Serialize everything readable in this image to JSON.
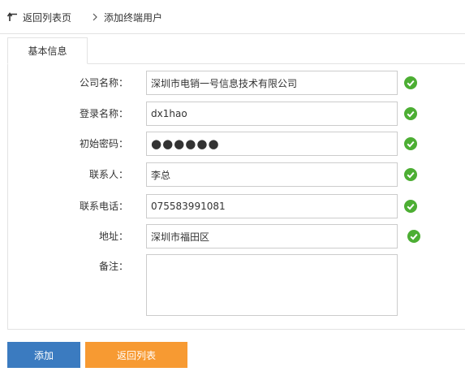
{
  "nav": {
    "back_label": "返回列表页",
    "crumb_label": "添加终端用户"
  },
  "tab": {
    "label": "基本信息"
  },
  "form": {
    "company_name": {
      "label": "公司名称：",
      "value": "深圳市电销一号信息技术有限公司"
    },
    "login_name": {
      "label": "登录名称：",
      "value": "dx1hao"
    },
    "initial_password": {
      "label": "初始密码：",
      "value": "●●●●●●"
    },
    "contact": {
      "label": "联系人：",
      "value": "李总"
    },
    "phone": {
      "label": "联系电话：",
      "value": "075583991081"
    },
    "address": {
      "label": "地址：",
      "value": "深圳市福田区"
    },
    "remark": {
      "label": "备注：",
      "value": ""
    }
  },
  "actions": {
    "add_label": "添加",
    "back_label": "返回列表"
  },
  "colors": {
    "add_button": "#3b7bc0",
    "back_button": "#f79a32",
    "valid_check": "#4cae33"
  }
}
